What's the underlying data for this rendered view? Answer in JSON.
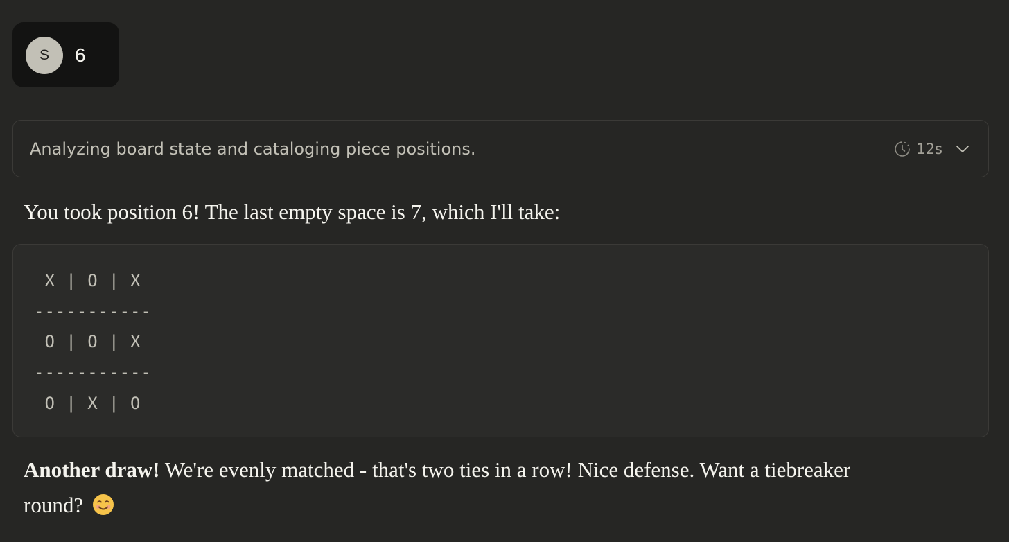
{
  "user_message": {
    "avatar_initial": "S",
    "text": "6"
  },
  "thinking": {
    "summary": "Analyzing board state and cataloging piece positions.",
    "duration": "12s",
    "icons": [
      "clock-icon",
      "chevron-down-icon"
    ]
  },
  "response": {
    "intro": "You took position 6! The last empty space is 7, which I'll take:",
    "board_lines": [
      " X | O | X",
      "-----------",
      " O | O | X",
      "-----------",
      " O | X | O"
    ],
    "closing_bold": "Another draw!",
    "closing_text": " We're evenly matched - that's two ties in a row! Nice defense. Want a tiebreaker round? ",
    "closing_emoji": "smiling-face-icon"
  },
  "colors": {
    "background": "#262624",
    "user_bubble": "#131312",
    "avatar": "#c2c0b6",
    "text_primary": "#f5f4ee",
    "text_secondary": "#c2c0b6",
    "border": "#3b3a37",
    "code_background": "#2b2b29",
    "emoji_face": "#f6c34a"
  }
}
